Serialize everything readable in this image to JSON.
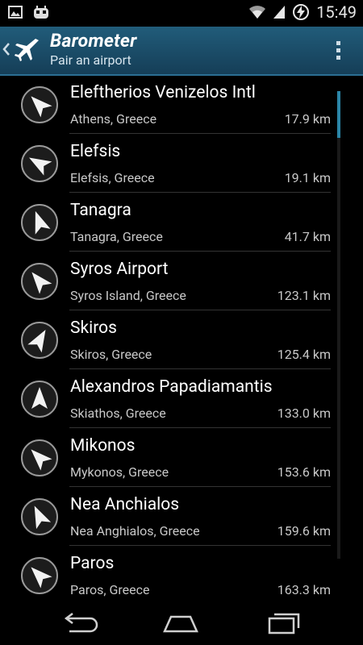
{
  "status": {
    "time": "15:49",
    "icons": [
      "image-icon",
      "android-icon",
      "wifi-icon",
      "signal-icon",
      "battery-charging-icon"
    ]
  },
  "actionbar": {
    "title": "Barometer",
    "subtitle": "Pair an airport"
  },
  "airports": [
    {
      "name": "Eleftherios Venizelos Intl",
      "city": "Athens, Greece",
      "distance": "17.9 km",
      "bearing_deg": -45
    },
    {
      "name": "Elefsis",
      "city": "Elefsis, Greece",
      "distance": "19.1 km",
      "bearing_deg": -60
    },
    {
      "name": "Tanagra",
      "city": "Tanagra, Greece",
      "distance": "41.7 km",
      "bearing_deg": -20
    },
    {
      "name": "Syros Airport",
      "city": "Syros Island, Greece",
      "distance": "123.1 km",
      "bearing_deg": -40
    },
    {
      "name": "Skiros",
      "city": "Skiros, Greece",
      "distance": "125.4 km",
      "bearing_deg": 30
    },
    {
      "name": "Alexandros Papadiamantis",
      "city": "Skiathos, Greece",
      "distance": "133.0 km",
      "bearing_deg": 0
    },
    {
      "name": "Mikonos",
      "city": "Mykonos, Greece",
      "distance": "153.6 km",
      "bearing_deg": -45
    },
    {
      "name": "Nea Anchialos",
      "city": "Nea Anghialos, Greece",
      "distance": "159.6 km",
      "bearing_deg": -25
    },
    {
      "name": "Paros",
      "city": "Paros, Greece",
      "distance": "163.3 km",
      "bearing_deg": -45
    }
  ],
  "navbar": {
    "buttons": [
      "back-icon",
      "home-icon",
      "recent-apps-icon"
    ]
  },
  "colors": {
    "actionbar": "#1d5070",
    "accent": "#33b5e5"
  }
}
